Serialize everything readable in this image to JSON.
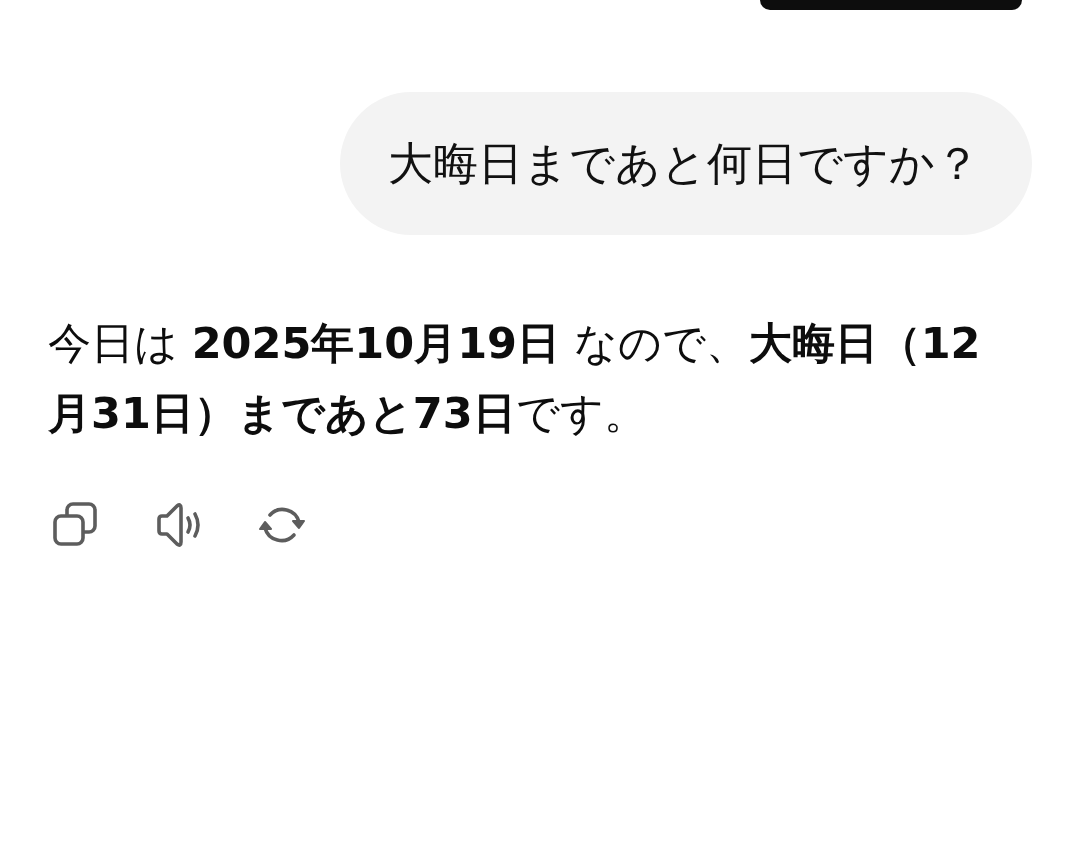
{
  "messages": [
    {
      "kind": "user",
      "text": "大晦日まであと何日ですか？"
    },
    {
      "kind": "assistant",
      "text": "今日は **2025年10月19日** なので、**大晦日（12月31日）まであと73日**です。"
    }
  ],
  "actions": [
    {
      "kind": "copy"
    },
    {
      "kind": "speak"
    },
    {
      "kind": "regenerate"
    }
  ]
}
